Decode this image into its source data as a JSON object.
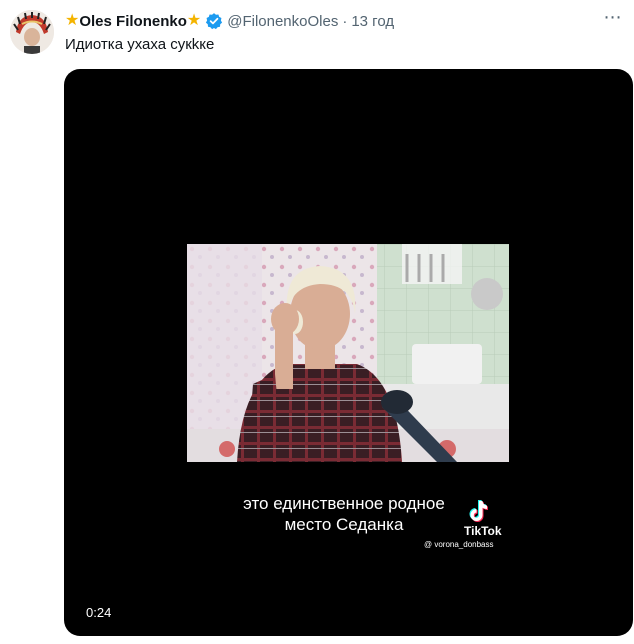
{
  "tweet": {
    "author_name": "Oles Filonenko",
    "star_glyph": "★",
    "handle": "@FilonenkoOles",
    "separator": "·",
    "time": "13 год",
    "more_icon": "⋯",
    "text": "Идиотка ухаха сукkке",
    "avatar_icon": "avatar-feather-headdress",
    "verified_color": "#1d9bf0",
    "star_color": "#f4b400"
  },
  "video": {
    "caption_line1": "это единственное родное",
    "caption_line2": "место Седанка",
    "tiktok_label": "TikTok",
    "tiktok_user": "@ vorona_donbass",
    "duration": "0:24"
  }
}
